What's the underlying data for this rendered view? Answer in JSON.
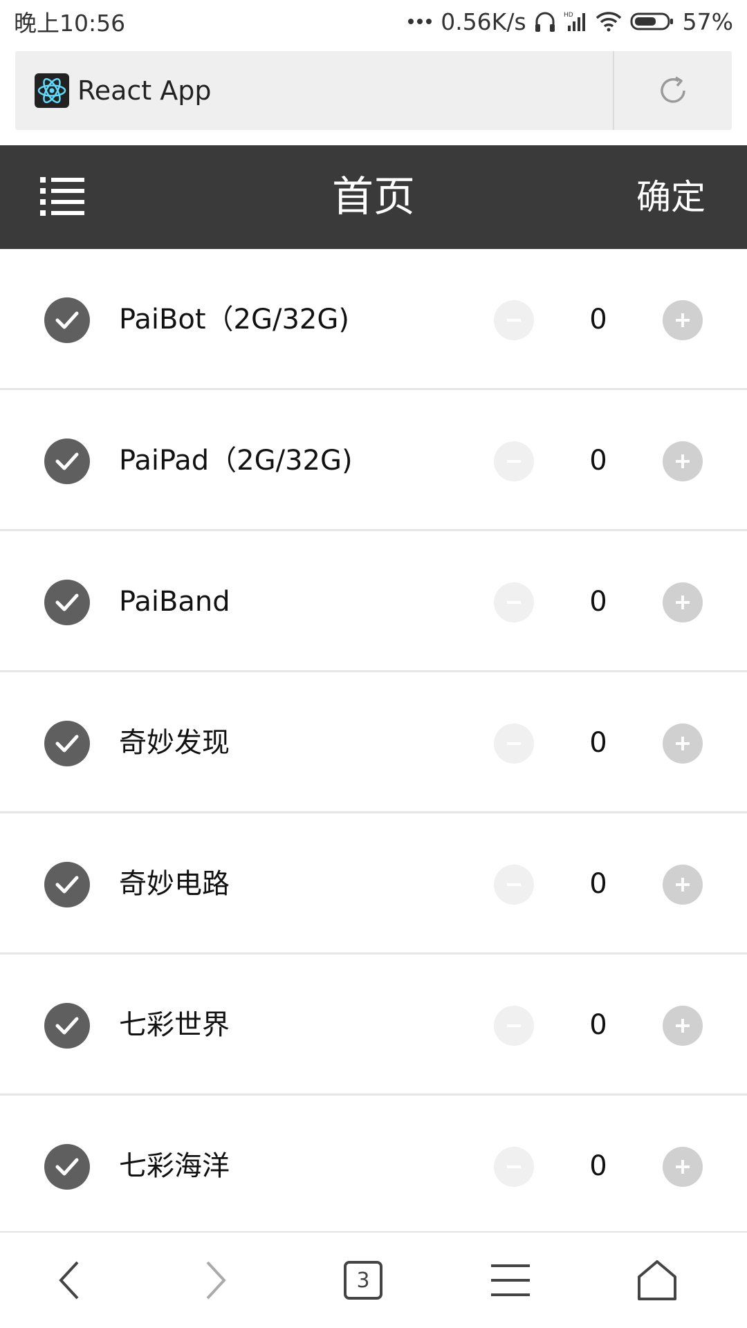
{
  "status_bar": {
    "time": "晚上10:56",
    "network_speed": "0.56K/s",
    "battery": "57%",
    "icons": [
      "more-dots-icon",
      "headphone-icon",
      "hd-signal-icon",
      "wifi-icon",
      "battery-icon"
    ]
  },
  "browser": {
    "page_title": "React App",
    "tab_count": "3"
  },
  "header": {
    "title": "首页",
    "confirm_label": "确定"
  },
  "products": [
    {
      "name": "PaiBot（2G/32G)",
      "quantity": "0",
      "checked": true
    },
    {
      "name": "PaiPad（2G/32G)",
      "quantity": "0",
      "checked": true
    },
    {
      "name": "PaiBand",
      "quantity": "0",
      "checked": true
    },
    {
      "name": "奇妙发现",
      "quantity": "0",
      "checked": true
    },
    {
      "name": "奇妙电路",
      "quantity": "0",
      "checked": true
    },
    {
      "name": "七彩世界",
      "quantity": "0",
      "checked": true
    },
    {
      "name": "七彩海洋",
      "quantity": "0",
      "checked": true
    }
  ],
  "colors": {
    "header_bg": "#3a3a3a",
    "check_bg": "#5f5f5f",
    "minus_bg": "#f0f0f0",
    "plus_bg": "#d0d0d0"
  }
}
